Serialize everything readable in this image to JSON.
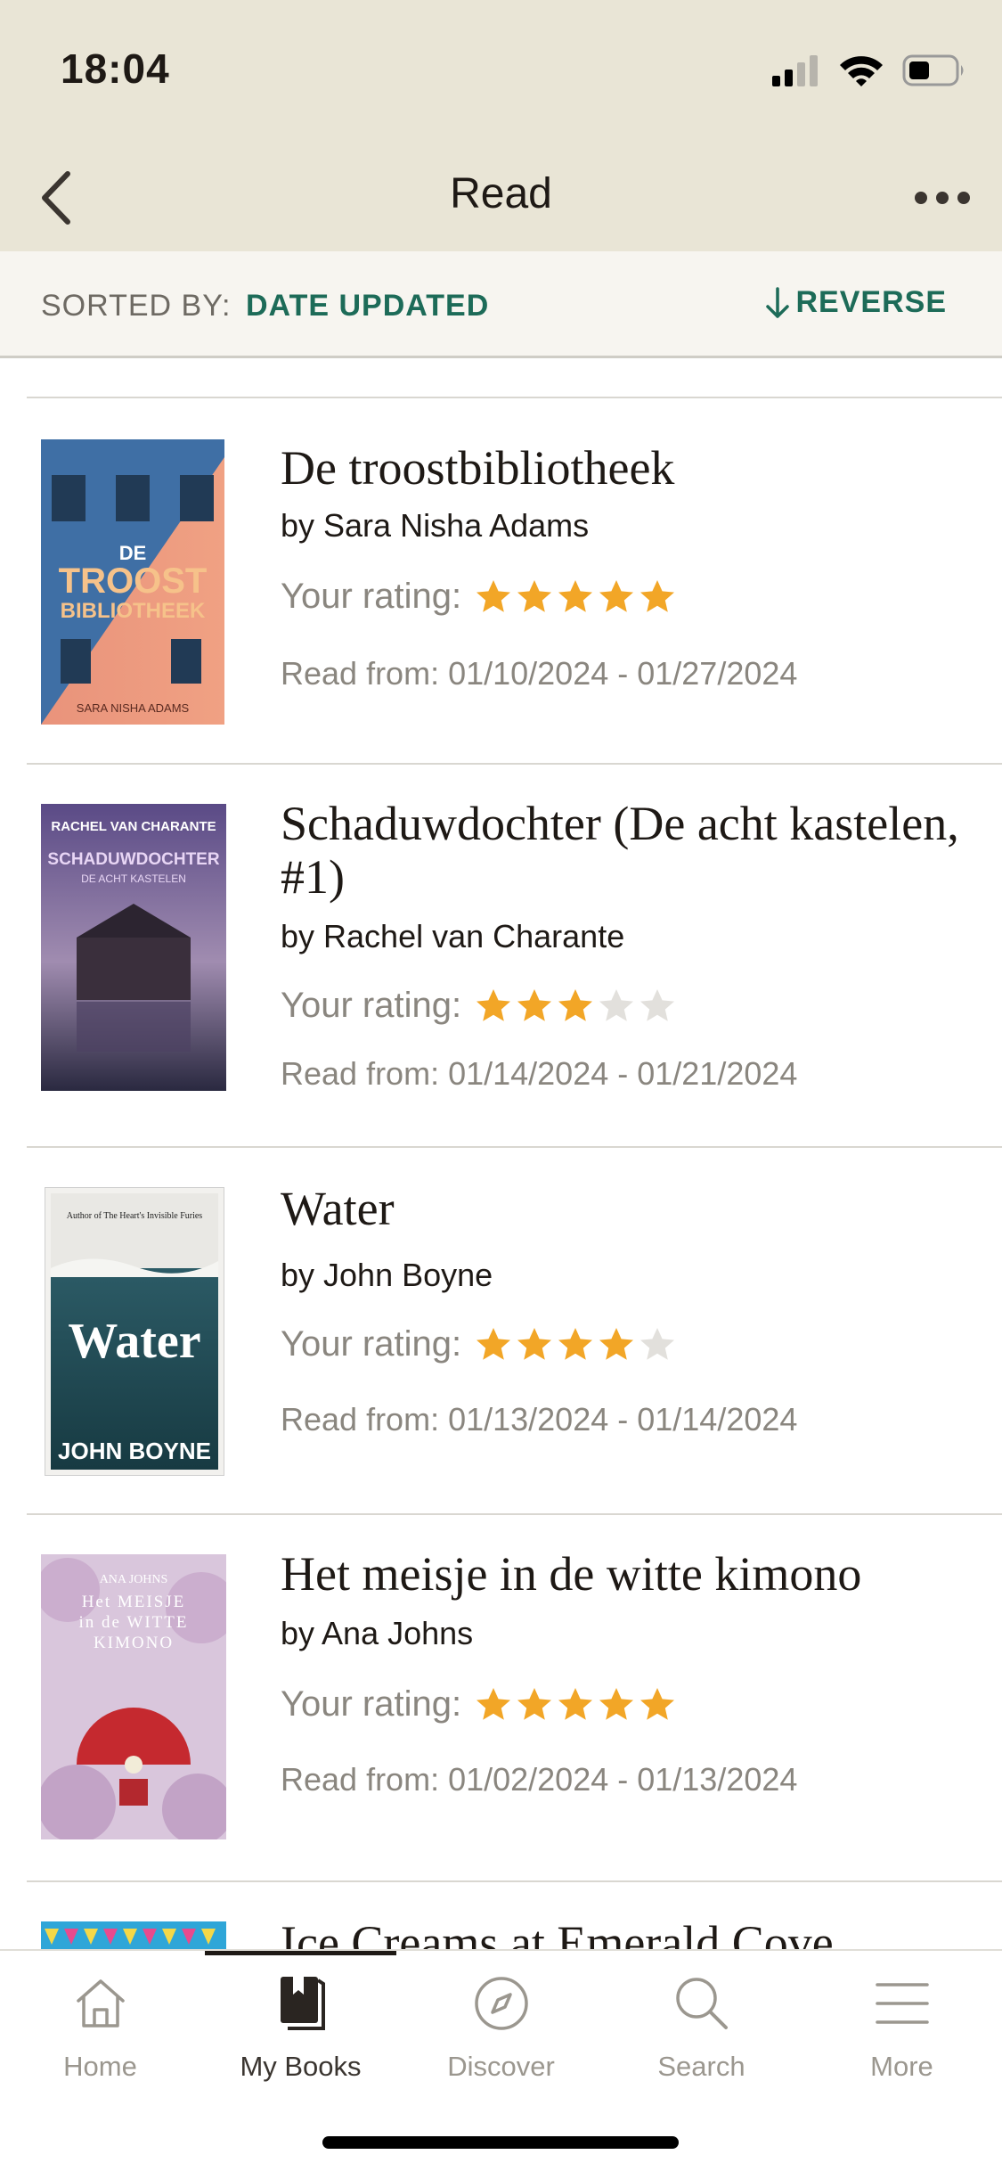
{
  "status_bar": {
    "time": "18:04",
    "battery_level": 0.45
  },
  "nav": {
    "title": "Read"
  },
  "sort": {
    "label": "SORTED BY:",
    "value": "DATE UPDATED",
    "reverse_label": "REVERSE"
  },
  "rating_label": "Your rating:",
  "books": [
    {
      "title": "De troostbibliotheek",
      "author": "by Sara Nisha Adams",
      "rating": 5,
      "dates": "Read from: 01/10/2024 - 01/27/2024",
      "cover": {
        "top_text": "DE",
        "main_text": "TROOST",
        "sub_text": "BIBLIOTHEEK",
        "author_text": "SARA NISHA ADAMS"
      }
    },
    {
      "title": "Schaduwdochter (De acht kastelen, #1)",
      "author": "by Rachel van Charante",
      "rating": 3,
      "dates": "Read from: 01/14/2024 - 01/21/2024",
      "cover": {
        "top_text": "RACHEL VAN CHARANTE",
        "main_text": "SCHADUWDOCHTER",
        "sub_text": "DE ACHT KASTELEN"
      }
    },
    {
      "title": "Water",
      "author": "by John Boyne",
      "rating": 4,
      "dates": "Read from: 01/13/2024 - 01/14/2024",
      "cover": {
        "top_text": "Author of The Heart's Invisible Furies",
        "main_text": "Water",
        "author_text": "JOHN BOYNE"
      }
    },
    {
      "title": "Het meisje in de witte kimono",
      "author": "by Ana Johns",
      "rating": 5,
      "dates": "Read from: 01/02/2024 - 01/13/2024",
      "cover": {
        "top_text": "ANA JOHNS",
        "main_text": "Het MEISJE in de WITTE KIMONO"
      }
    },
    {
      "title": "Ice Creams at Emerald Cove",
      "author": "",
      "rating": 0,
      "dates": ""
    }
  ],
  "tabs": [
    {
      "label": "Home",
      "icon": "home-icon"
    },
    {
      "label": "My Books",
      "icon": "book-icon",
      "active": true
    },
    {
      "label": "Discover",
      "icon": "compass-icon"
    },
    {
      "label": "Search",
      "icon": "search-icon"
    },
    {
      "label": "More",
      "icon": "menu-icon"
    }
  ],
  "colors": {
    "header_bg": "#e9e5d6",
    "accent": "#1d6b58",
    "star": "#f2a627",
    "star_empty": "#e2e0dc"
  }
}
